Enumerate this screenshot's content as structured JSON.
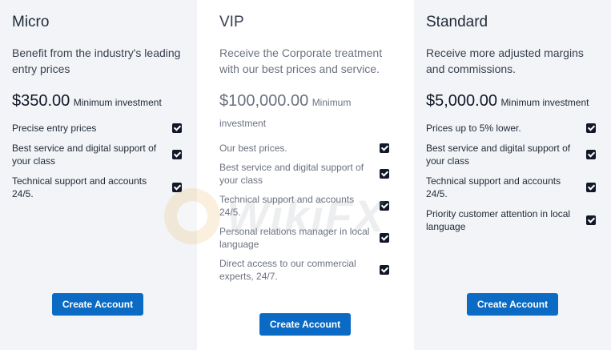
{
  "plans": [
    {
      "title": "Micro",
      "description": "Benefit from the industry's leading entry prices",
      "price": "$350.00",
      "price_note": "Minimum investment",
      "features": [
        "Precise entry prices",
        "Best service and digital support of your class",
        "Technical support and accounts 24/5."
      ],
      "cta_label": "Create Account"
    },
    {
      "title": "VIP",
      "description": "Receive the Corporate treatment with our best prices and service.",
      "price": "$100,000.00",
      "price_note": "Minimum investment",
      "features": [
        "Our best prices.",
        "Best service and digital support of your class",
        "Technical support and accounts 24/5.",
        "Personal relations manager in local language",
        "Direct access to our commercial experts, 24/7."
      ],
      "cta_label": "Create Account"
    },
    {
      "title": "Standard",
      "description": "Receive more adjusted margins and commissions.",
      "price": "$5,000.00",
      "price_note": "Minimum investment",
      "features": [
        "Prices up to 5% lower.",
        "Best service and digital support of your class",
        "Technical support and accounts 24/5.",
        "Priority customer attention in local language"
      ],
      "cta_label": "Create Account"
    }
  ],
  "watermark": {
    "text": "WikiFX"
  },
  "colors": {
    "cta_background": "#0b6bc4",
    "check_fill": "#111827",
    "side_panel": "#f2f4f7",
    "featured_panel": "#ffffff"
  },
  "icons": {
    "feature_check": "checkbox-checked-icon",
    "watermark_logo": "wikifx-logo-icon"
  }
}
